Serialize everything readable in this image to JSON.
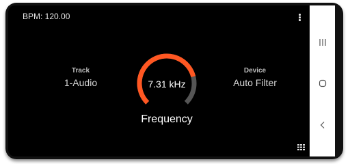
{
  "header": {
    "bpm_label": "BPM: 120.00",
    "menu_icon": "kebab-menu-icon"
  },
  "track": {
    "title": "Track",
    "value": "1-Audio"
  },
  "device": {
    "title": "Device",
    "value": "Auto Filter"
  },
  "knob": {
    "value_text": "7.31 kHz",
    "parameter_name": "Frequency",
    "fill_fraction": 0.78,
    "active_color": "#ff5722",
    "track_color": "#555555"
  },
  "footer": {
    "view_icon": "grid-view-icon"
  },
  "system_nav": {
    "recents_icon": "recent-apps-icon",
    "home_icon": "home-icon",
    "back_icon": "back-icon"
  }
}
